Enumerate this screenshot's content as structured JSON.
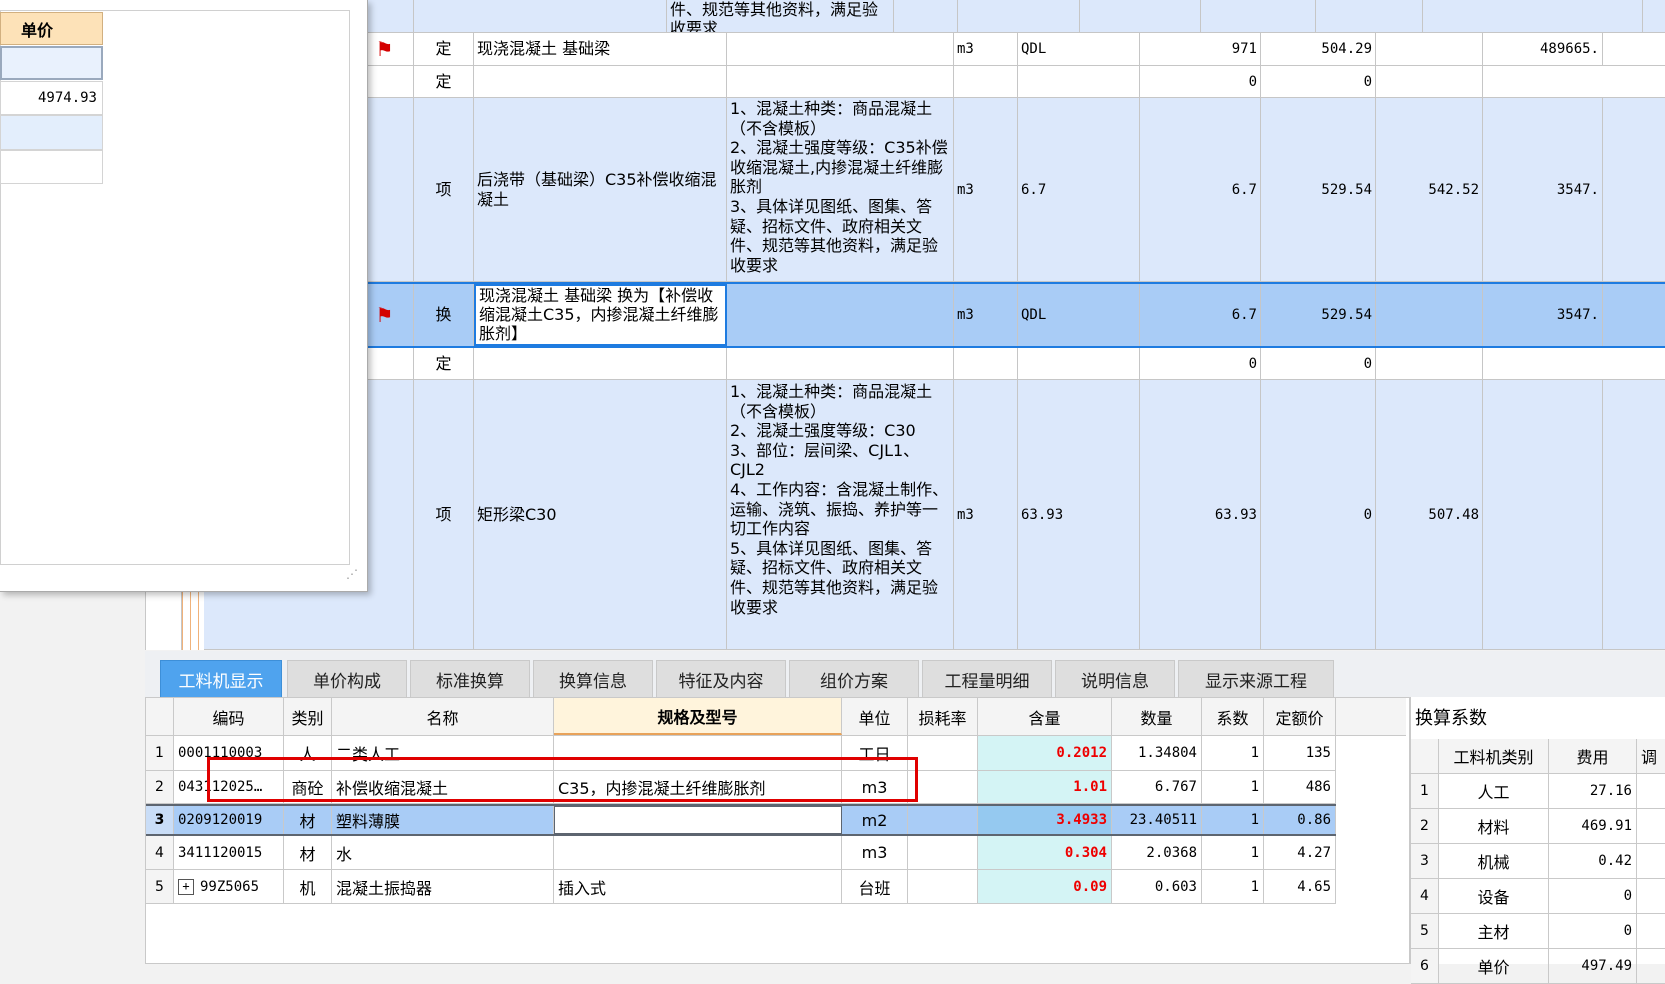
{
  "popup": {
    "header": "单价",
    "value": "4974.93"
  },
  "top_rows": [
    {
      "desc": "件、规范等其他资料，满足验\n收要求",
      "flag": false
    },
    {
      "type": "定",
      "name": "现浇混凝土 基础梁",
      "unit": "m3",
      "expr": "QDL",
      "qty": "971",
      "price": "504.29",
      "p2": "",
      "total": "489665.",
      "flag": true
    },
    {
      "type": "定",
      "qty": "0",
      "price": "0"
    },
    {
      "type": "项",
      "name": "后浇带（基础梁）C35补偿收缩混凝土",
      "desc": "1、混凝土种类：商品混凝土（不含模板）\n2、混凝土强度等级：C35补偿收缩混凝土,内掺混凝土纤维膨胀剂\n3、具体详见图纸、图集、答疑、招标文件、政府相关文件、规范等其他资料，满足验收要求",
      "unit": "m3",
      "expr": "6.7",
      "qty": "6.7",
      "price": "529.54",
      "p2": "542.52",
      "total": "3547."
    },
    {
      "type": "换",
      "name": "现浇混凝土 基础梁  换为【补偿收缩混凝土C35，内掺混凝土纤维膨胀剂】",
      "unit": "m3",
      "expr": "QDL",
      "qty": "6.7",
      "price": "529.54",
      "total": "3547.",
      "flag": true
    },
    {
      "type": "定",
      "qty": "0",
      "price": "0"
    },
    {
      "type": "项",
      "name": "矩形梁C30",
      "desc": "1、混凝土种类：商品混凝土（不含模板）\n2、混凝土强度等级：C30\n3、部位：层间梁、CJL1、CJL2\n4、工作内容：含混凝土制作、运输、浇筑、振捣、养护等一切工作内容\n5、具体详见图纸、图集、答疑、招标文件、政府相关文件、规范等其他资料，满足验收要求",
      "unit": "m3",
      "expr": "63.93",
      "qty": "63.93",
      "price": "0",
      "p2": "507.48"
    }
  ],
  "tabs": [
    "工料机显示",
    "单价构成",
    "标准换算",
    "换算信息",
    "特征及内容",
    "组价方案",
    "工程量明细",
    "说明信息",
    "显示来源工程"
  ],
  "bottom_headers": [
    "编码",
    "类别",
    "名称",
    "规格及型号",
    "单位",
    "损耗率",
    "含量",
    "数量",
    "系数",
    "定额价"
  ],
  "bottom_rows": [
    {
      "no": "1",
      "code": "0001110003",
      "cat": "人",
      "name": "二类人工",
      "spec": "",
      "unit": "工日",
      "content": "0.2012",
      "qty": "1.34804",
      "coef": "1",
      "price": "135"
    },
    {
      "no": "2",
      "code": "043112025…",
      "cat": "商砼",
      "name": "补偿收缩混凝土",
      "spec": "C35，内掺混凝土纤维膨胀剂",
      "unit": "m3",
      "content": "1.01",
      "qty": "6.767",
      "coef": "1",
      "price": "486"
    },
    {
      "no": "3",
      "code": "0209120019",
      "cat": "材",
      "name": "塑料薄膜",
      "spec": "",
      "unit": "m2",
      "content": "3.4933",
      "qty": "23.40511",
      "coef": "1",
      "price": "0.86"
    },
    {
      "no": "4",
      "code": "3411120015",
      "cat": "材",
      "name": "水",
      "spec": "",
      "unit": "m3",
      "content": "0.304",
      "qty": "2.0368",
      "coef": "1",
      "price": "4.27"
    },
    {
      "no": "5",
      "code": "99Z5065",
      "cat": "机",
      "name": "混凝土振捣器",
      "spec": "插入式",
      "unit": "台班",
      "content": "0.09",
      "qty": "0.603",
      "coef": "1",
      "price": "4.65"
    }
  ],
  "right_panel": {
    "title": "换算系数",
    "headers": [
      "工料机类别",
      "费用",
      "调"
    ],
    "rows": [
      {
        "no": "1",
        "cat": "人工",
        "fee": "27.16"
      },
      {
        "no": "2",
        "cat": "材料",
        "fee": "469.91"
      },
      {
        "no": "3",
        "cat": "机械",
        "fee": "0.42"
      },
      {
        "no": "4",
        "cat": "设备",
        "fee": "0"
      },
      {
        "no": "5",
        "cat": "主材",
        "fee": "0"
      },
      {
        "no": "6",
        "cat": "单价",
        "fee": "497.49"
      }
    ]
  },
  "colors": {
    "selection_border": "#1e7be0",
    "tab_active": "#4fa3ee",
    "highlight_red": "#e00000",
    "content_cyan": "#d4f4f5"
  }
}
